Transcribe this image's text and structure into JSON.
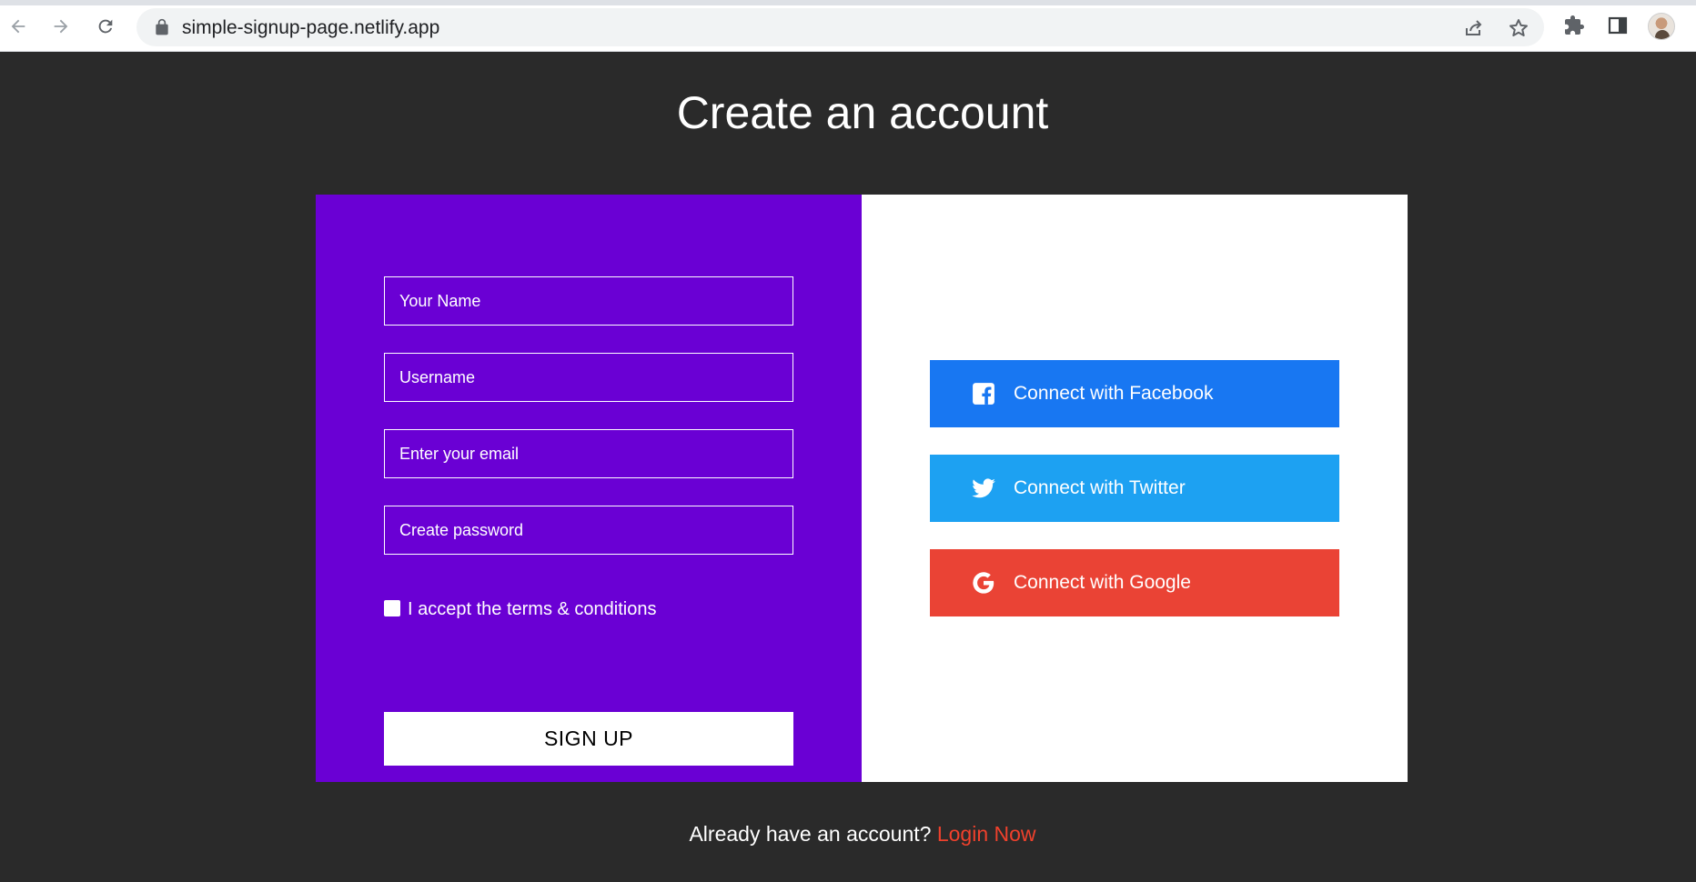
{
  "browser": {
    "url": "simple-signup-page.netlify.app",
    "icons": {
      "back": "back-arrow-icon",
      "forward": "forward-arrow-icon",
      "reload": "reload-icon",
      "lock": "lock-icon",
      "share": "share-icon",
      "bookmark": "star-icon",
      "extensions": "puzzle-icon",
      "side_panel": "side-panel-icon",
      "profile": "avatar"
    }
  },
  "page": {
    "title": "Create an account",
    "colors": {
      "background": "#2a2a2a",
      "form_panel": "#6a00d4",
      "facebook": "#1877f2",
      "twitter": "#1da1f2",
      "google": "#ea4335",
      "login_link": "#f0412c"
    }
  },
  "form": {
    "fields": [
      {
        "name": "name",
        "placeholder": "Your Name",
        "value": ""
      },
      {
        "name": "username",
        "placeholder": "Username",
        "value": ""
      },
      {
        "name": "email",
        "placeholder": "Enter your email",
        "value": ""
      },
      {
        "name": "password",
        "placeholder": "Create password",
        "value": ""
      }
    ],
    "terms_label": "I accept the terms & conditions",
    "terms_checked": false,
    "submit_label": "SIGN UP"
  },
  "social": {
    "facebook_label": "Connect with Facebook",
    "twitter_label": "Connect with Twitter",
    "google_label": "Connect with Google"
  },
  "footer": {
    "question": "Already have an account?",
    "login_label": "Login Now"
  }
}
